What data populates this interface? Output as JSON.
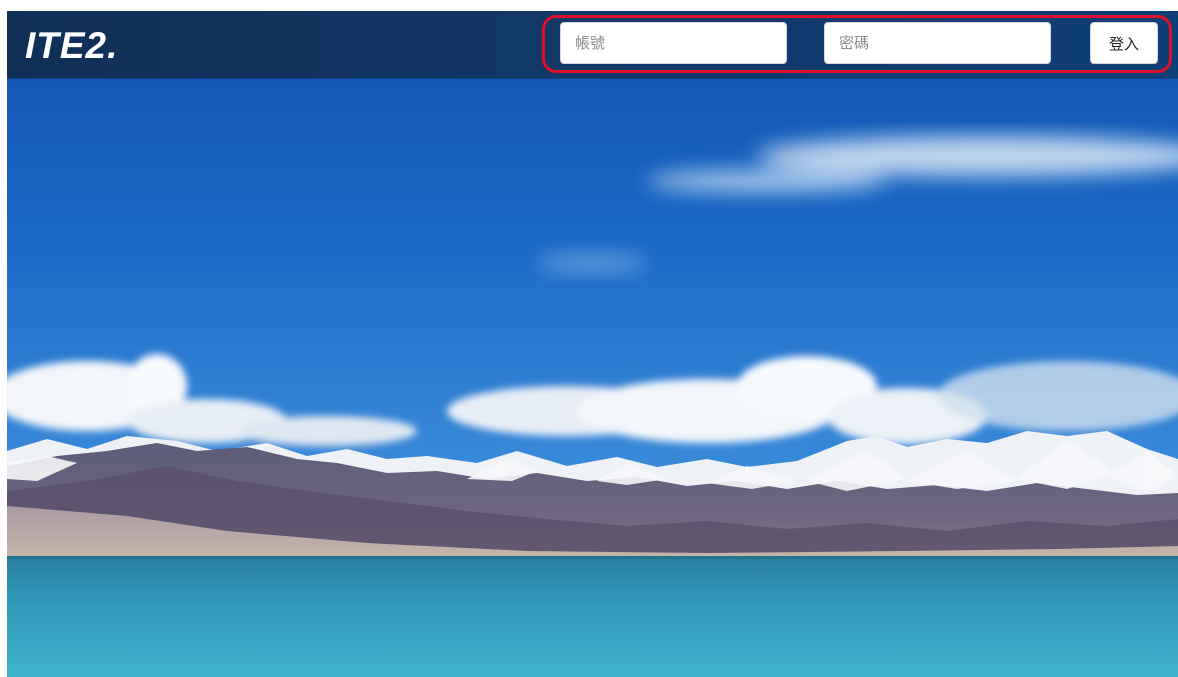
{
  "header": {
    "logo_text": "ITE2.",
    "username_placeholder": "帳號",
    "password_placeholder": "密碼",
    "login_label": "登入"
  },
  "colors": {
    "header_bg": "#123866",
    "highlight": "#e0102a",
    "sky_top": "#1c66c7",
    "sky_bottom": "#5aa3e6",
    "lake": "#2d93b5"
  }
}
